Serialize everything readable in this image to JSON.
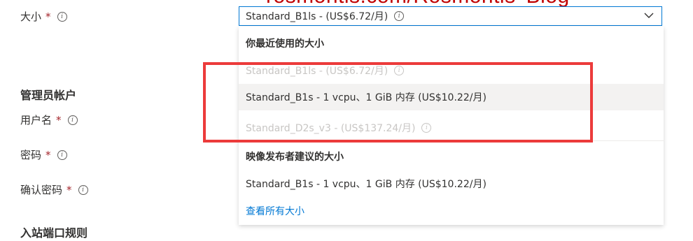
{
  "watermark": "rosmontis.com/Rosmontis' Blog",
  "size_field": {
    "label": "大小",
    "required": "*",
    "value": "Standard_B1ls - (US$6.72/月)"
  },
  "dropdown": {
    "recent_header": "你最近使用的大小",
    "recent_items": [
      {
        "label": "Standard_B1ls - (US$6.72/月)",
        "state": "disabled",
        "info": true
      },
      {
        "label": "Standard_B1s - 1 vcpu、1 GiB 内存 (US$10.22/月)",
        "state": "hover",
        "info": false
      },
      {
        "label": "Standard_D2s_v3 - (US$137.24/月)",
        "state": "disabled",
        "info": true
      }
    ],
    "publisher_header": "映像发布者建议的大小",
    "publisher_items": [
      {
        "label": "Standard_B1s - 1 vcpu、1 GiB 内存 (US$10.22/月)"
      }
    ],
    "see_all_link": "查看所有大小"
  },
  "admin_section": {
    "title": "管理员帐户",
    "username_label": "用户名",
    "password_label": "密码",
    "confirm_password_label": "确认密码",
    "required": "*"
  },
  "inbound_section": {
    "title": "入站端口规则"
  },
  "colors": {
    "accent": "#0078d4",
    "highlight": "#ec3b3b",
    "required": "#a4262c"
  }
}
